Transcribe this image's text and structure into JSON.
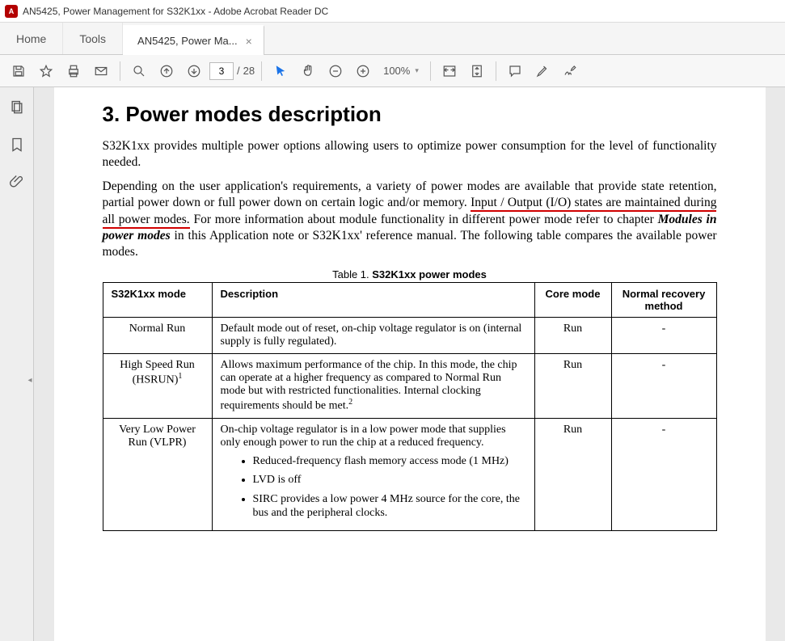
{
  "titlebar": {
    "app_icon_label": "A",
    "title": "AN5425, Power Management for S32K1xx - Adobe Acrobat Reader DC"
  },
  "tabs": {
    "home": "Home",
    "tools": "Tools",
    "doc": "AN5425, Power Ma...",
    "close": "×"
  },
  "toolbar": {
    "page_current": "3",
    "page_sep": "/",
    "page_total": "28",
    "zoom": "100%",
    "zoom_dd": "▾"
  },
  "rail_collapse": "◂",
  "document": {
    "heading": "3. Power modes description",
    "para1": "S32K1xx provides multiple power options allowing users to optimize power consumption for the level of functionality needed.",
    "para2_a": "Depending on the user application's requirements, a variety of power modes are available that provide state retention, partial power down or full power down on certain logic and/or memory. ",
    "para2_underlined": "Input / Output (I/O) states are maintained during all power modes.",
    "para2_b": " For more information about module functionality in different power mode refer to chapter ",
    "para2_modref": "Modules in power modes",
    "para2_c": " in this Application note or S32K1xx' reference manual. The following table compares the available power modes.",
    "table_caption_a": "Table 1.    ",
    "table_caption_b": "S32K1xx power modes",
    "headers": {
      "mode": "S32K1xx mode",
      "desc": "Description",
      "core": "Core mode",
      "recovery": "Normal recovery method"
    },
    "rows": [
      {
        "mode": "Normal Run",
        "desc": "Default mode out of reset, on-chip voltage regulator is on (internal supply is fully regulated).",
        "core": "Run",
        "recovery": "-"
      },
      {
        "mode": "High Speed Run (HSRUN)",
        "mode_sup": "1",
        "desc": "Allows maximum performance of the chip. In this mode, the chip can operate at a higher frequency as compared to Normal Run mode but with restricted functionalities. Internal clocking requirements should be met.",
        "desc_sup": "2",
        "core": "Run",
        "recovery": "-"
      },
      {
        "mode": "Very Low Power Run (VLPR)",
        "desc": "On-chip voltage regulator is in a low power mode that supplies only enough power to run the chip at a reduced frequency.",
        "bullets": [
          "Reduced-frequency flash memory access mode (1 MHz)",
          "LVD is off",
          "SIRC provides a low power 4 MHz source for the core, the bus and the peripheral clocks."
        ],
        "core": "Run",
        "recovery": "-"
      }
    ]
  }
}
